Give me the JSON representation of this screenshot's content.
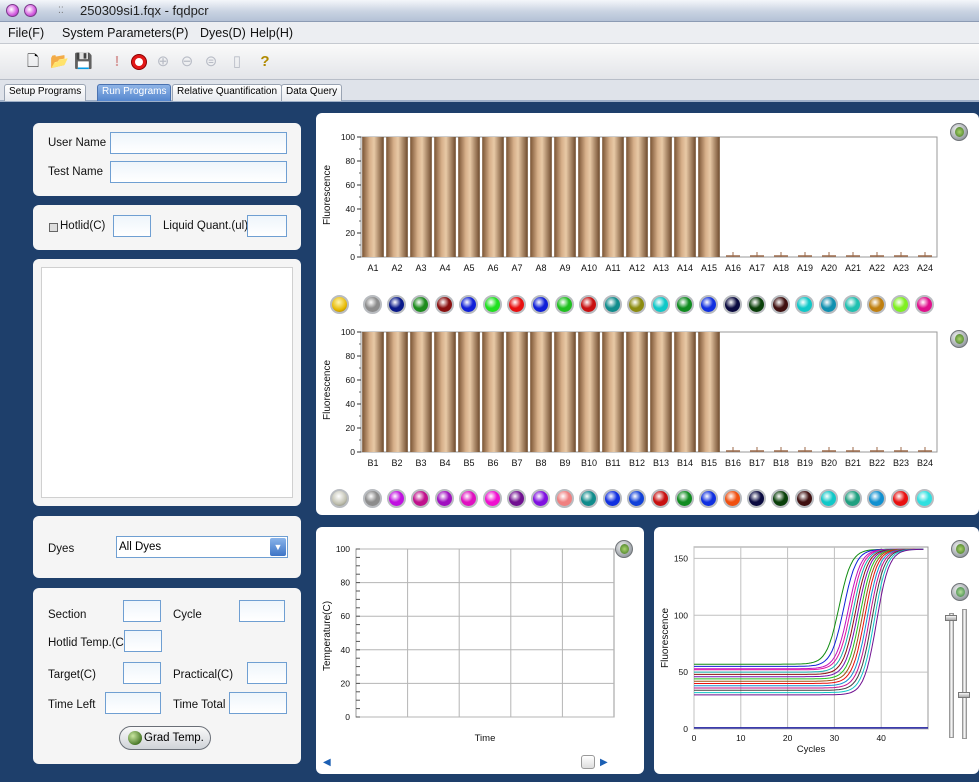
{
  "window": {
    "title": "250309si1.fqx - fqdpcr"
  },
  "menu": [
    "File(F)",
    "System Parameters(P)",
    "Dyes(D)",
    "Help(H)"
  ],
  "toolbar": {
    "icons": [
      "new-file-icon",
      "open-folder-icon",
      "save-icon",
      "warning-icon",
      "stop-icon",
      "zoom-in-icon",
      "zoom-out-icon",
      "zoom-reset-icon",
      "report-icon",
      "help-icon"
    ]
  },
  "tabs": [
    "Setup Programs",
    "Run Programs",
    "Relative Quantification",
    "Data Query"
  ],
  "active_tab": "Run Programs",
  "left_panel": {
    "user_name_label": "User Name",
    "test_name_label": "Test Name",
    "hotlid_label": "Hotlid(C)",
    "liquid_label": "Liquid Quant.(ul)",
    "dyes_label": "Dyes",
    "dyes_value": "All Dyes",
    "section_label": "Section",
    "cycle_label": "Cycle",
    "hotlid_temp_label": "Hotlid Temp.(C)",
    "target_label": "Target(C)",
    "practical_label": "Practical(C)",
    "time_left_label": "Time Left",
    "time_total_label": "Time Total",
    "grad_button": "Grad Temp."
  },
  "chart_data": [
    {
      "type": "bar",
      "ylabel": "Fluorescence",
      "ylim": [
        0,
        100
      ],
      "yticks": [
        0,
        20,
        40,
        60,
        80,
        100
      ],
      "categories": [
        "A1",
        "A2",
        "A3",
        "A4",
        "A5",
        "A6",
        "A7",
        "A8",
        "A9",
        "A10",
        "A11",
        "A12",
        "A13",
        "A14",
        "A15",
        "A16",
        "A17",
        "A18",
        "A19",
        "A20",
        "A21",
        "A22",
        "A23",
        "A24"
      ],
      "values": [
        100,
        100,
        100,
        100,
        100,
        100,
        100,
        100,
        100,
        100,
        100,
        100,
        100,
        100,
        100,
        0,
        0,
        0,
        0,
        0,
        0,
        0,
        0,
        0
      ],
      "well_colors": [
        "#8c8c8c",
        "#0a1a8a",
        "#1e8c1e",
        "#8a1010",
        "#1020d8",
        "#20e020",
        "#e81010",
        "#1020d8",
        "#20c020",
        "#c81010",
        "#108c8c",
        "#8c8c10",
        "#10c8c8",
        "#108c20",
        "#1030e0",
        "#0a0a40",
        "#0a400a",
        "#401010",
        "#10c8c8",
        "#1090b0",
        "#20c0b0",
        "#c08010",
        "#80f020",
        "#e0108c"
      ]
    },
    {
      "type": "bar",
      "ylabel": "Fluorescence",
      "ylim": [
        0,
        100
      ],
      "yticks": [
        0,
        20,
        40,
        60,
        80,
        100
      ],
      "categories": [
        "B1",
        "B2",
        "B3",
        "B4",
        "B5",
        "B6",
        "B7",
        "B8",
        "B9",
        "B10",
        "B11",
        "B12",
        "B13",
        "B14",
        "B15",
        "B16",
        "B17",
        "B18",
        "B19",
        "B20",
        "B21",
        "B22",
        "B23",
        "B24"
      ],
      "values": [
        100,
        100,
        100,
        100,
        100,
        100,
        100,
        100,
        100,
        100,
        100,
        100,
        100,
        100,
        100,
        0,
        0,
        0,
        0,
        0,
        0,
        0,
        0,
        0
      ],
      "well_colors": [
        "#8c8c8c",
        "#c010e0",
        "#c0108c",
        "#a010c0",
        "#e010c0",
        "#f010d0",
        "#701090",
        "#8010e0",
        "#f08080",
        "#108c8c",
        "#1030e0",
        "#1040d8",
        "#c81010",
        "#108c20",
        "#1030e0",
        "#f05010",
        "#0a0a40",
        "#0a400a",
        "#401010",
        "#10c8c8",
        "#20a080",
        "#1090d0",
        "#e81010",
        "#30e0e0"
      ]
    },
    {
      "type": "line",
      "xlabel": "Time",
      "ylabel": "Temperature(C)",
      "ylim": [
        0,
        100
      ],
      "yticks": [
        0,
        20,
        40,
        60,
        80,
        100
      ],
      "series": []
    },
    {
      "type": "line",
      "xlabel": "Cycles",
      "ylabel": "Fluorescence",
      "xlim": [
        0,
        50
      ],
      "ylim": [
        0,
        160
      ],
      "xticks": [
        0,
        10,
        20,
        30,
        40
      ],
      "yticks": [
        0,
        50,
        100,
        150
      ],
      "series_colors": [
        "#108c10",
        "#1020d8",
        "#c010c0",
        "#e010a0",
        "#10b0b0",
        "#8c1010",
        "#7010b0",
        "#20c020",
        "#a05010",
        "#e81010",
        "#1090d0",
        "#c0108c",
        "#404040",
        "#10c8c8",
        "#701090"
      ],
      "series_baselines": [
        57,
        55,
        53,
        52,
        50,
        48,
        46,
        44,
        42,
        40,
        38,
        36,
        34,
        32,
        30
      ],
      "series_midpoints": [
        31,
        32,
        33,
        33.5,
        34,
        34.5,
        35,
        35.5,
        36,
        36.5,
        37,
        37.5,
        38,
        38.5,
        39
      ]
    }
  ]
}
